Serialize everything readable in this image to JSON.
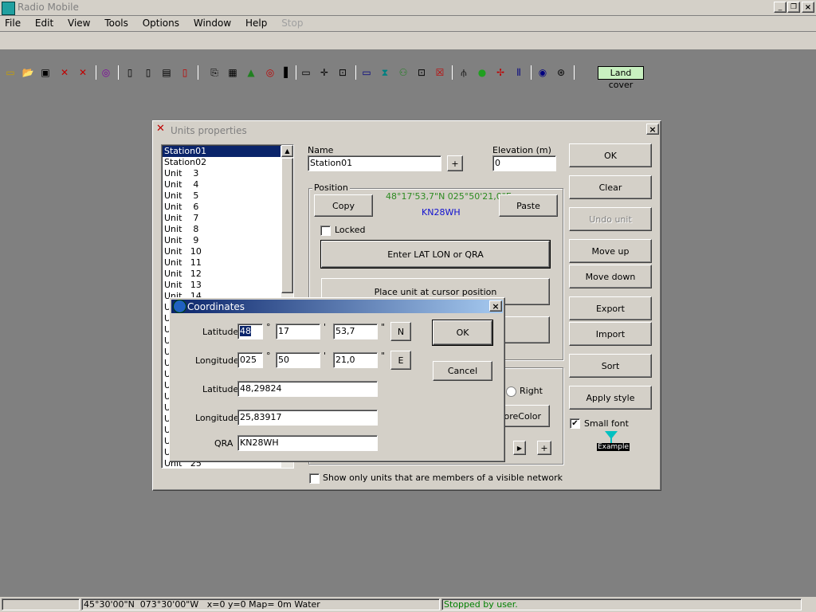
{
  "app": {
    "title": "Radio Mobile"
  },
  "menu": {
    "items": [
      "File",
      "Edit",
      "View",
      "Tools",
      "Options",
      "Window",
      "Help",
      "Stop"
    ]
  },
  "toolbar": {
    "land_cover_label": "Land cover"
  },
  "units_dialog": {
    "title": "Units properties",
    "list_items": [
      "Station01",
      "Station02",
      "Unit    3",
      "Unit    4",
      "Unit    5",
      "Unit    6",
      "Unit    7",
      "Unit    8",
      "Unit    9",
      "Unit   10",
      "Unit   11",
      "Unit   12",
      "Unit   13",
      "Unit   14",
      "U",
      "U",
      "U",
      "U",
      "U",
      "U",
      "U",
      "U",
      "U",
      "U",
      "U",
      "U",
      "U",
      "U",
      "Unit   25"
    ],
    "name_label": "Name",
    "name_value": "Station01",
    "plus_label": "+",
    "elevation_label": "Elevation (m)",
    "elevation_value": "0",
    "position_label": "Position",
    "copy_label": "Copy",
    "coords_text": "48°17'53,7\"N 025°50'21,0\"E",
    "qra_text": "KN28WH",
    "paste_label": "Paste",
    "locked_label": "Locked",
    "enter_latlon_label": "Enter LAT LON or QRA",
    "place_cursor_label": "Place unit at cursor position",
    "right_label": "Right",
    "forecolor_label": "ForeColor",
    "plus2_label": "+",
    "show_only_label": "Show only units that are members of a visible network",
    "buttons": {
      "ok": "OK",
      "clear": "Clear",
      "undo": "Undo unit",
      "move_up": "Move up",
      "move_down": "Move down",
      "export": "Export",
      "import": "Import",
      "sort": "Sort",
      "apply_style": "Apply style"
    },
    "small_font_label": "Small font",
    "example_label": "Example"
  },
  "coords_dialog": {
    "title": "Coordinates",
    "latitude_label": "Latitude",
    "longitude_label": "Longitude",
    "lat_deg": "48",
    "lat_min": "17",
    "lat_sec": "53,7",
    "lat_hem": "N",
    "lon_deg": "025",
    "lon_min": "50",
    "lon_sec": "21,0",
    "lon_hem": "E",
    "deg_sym": "°",
    "min_sym": "'",
    "sec_sym": "\"",
    "lat_decimal_label": "Latitude",
    "lat_decimal": "48,29824",
    "lon_decimal_label": "Longitude",
    "lon_decimal": "25,83917",
    "qra_label": "QRA",
    "qra_value": "KN28WH",
    "ok_label": "OK",
    "cancel_label": "Cancel"
  },
  "statusbar": {
    "position_text": "45°30'00\"N  073°30'00\"W   x=0 y=0 Map= 0m Water",
    "status_text": "Stopped by user."
  },
  "colors": {
    "accent": "#0a246a",
    "coords_green": "#2e8b22",
    "qra_blue": "#1010d0",
    "status_green": "#008000",
    "land_cover_bg": "#c8f0c0"
  }
}
